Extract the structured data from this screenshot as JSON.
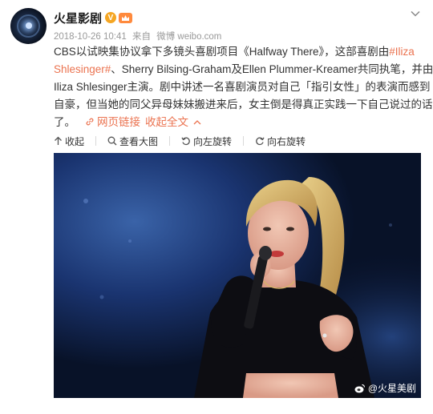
{
  "post": {
    "author": "火星影剧",
    "verified": "V",
    "date": "2018-10-26 10:41",
    "source_prefix": "来自",
    "source": "微博 weibo.com",
    "text": {
      "line1_a": "CBS以试映集协议拿下多镜头喜剧项目《Halfway There》，这部喜剧由",
      "line1_link": "#Iliza",
      "line2_link": "Shlesinger#",
      "line2_b": "、Sherry Bilsing-Graham及Ellen Plummer-Kreamer共同执笔，并由",
      "line3": "Iliza Shlesinger主演。剧中讲述一名喜剧演员对自己「指引女性」的表演而感到",
      "line4": "自豪，但当她的同父异母妹妹搬进来后，女主倒是得真正实践一下自己说过的话",
      "line5": "了。",
      "web_link": "网页链接",
      "collapse": "收起全文"
    }
  },
  "toolbar": {
    "collapse": "收起",
    "view_large": "查看大图",
    "rotate_left": "向左旋转",
    "rotate_right": "向右旋转"
  },
  "image": {
    "watermark": "@火星美剧"
  },
  "colors": {
    "link": "#eb7350",
    "meta": "#999999",
    "verified": "#f5a623"
  }
}
